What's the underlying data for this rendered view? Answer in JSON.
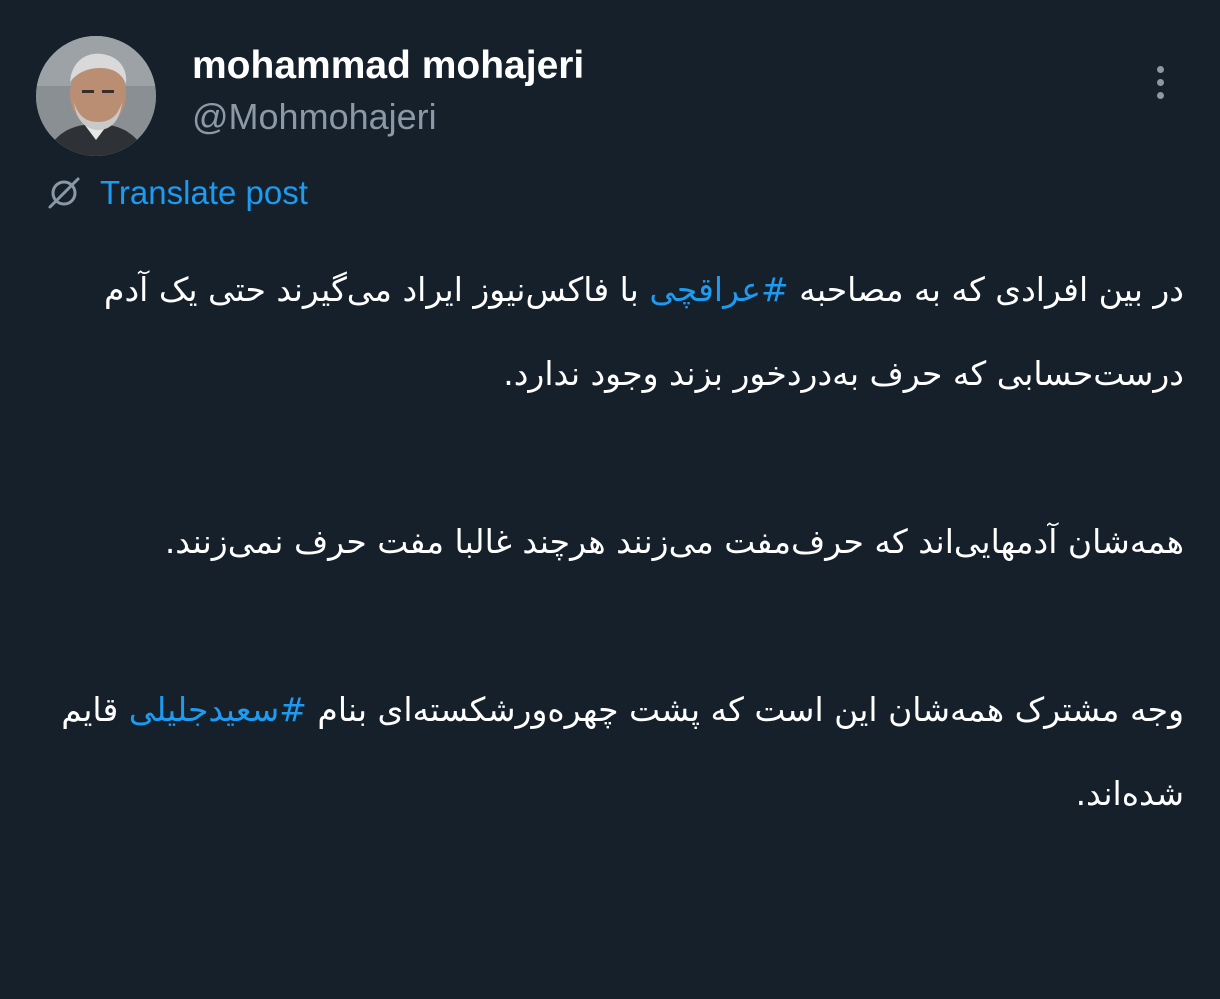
{
  "author": {
    "display_name": "mohammad mohajeri",
    "handle": "@Mohmohajeri",
    "avatar_icon": "profile-photo"
  },
  "menu": {
    "more_icon": "more-vertical-icon"
  },
  "translate": {
    "label": "Translate post",
    "icon": "translate-icon"
  },
  "post": {
    "p1": {
      "before": "در بین افرادی که به مصاحبه ",
      "hashtag": "#عراقچی",
      "after": " با فاکس‌نیوز ایراد می‌گیرند حتی یک آدم درست‌حسابی که حرف به‌دردخور بزند وجود ندارد."
    },
    "p2": "همه‌شان آدمهایی‌اند که حرف‌مفت می‌زنند هرچند غالبا مفت حرف نمی‌زنند.",
    "p3": {
      "before": "وجه مشترک همه‌شان این است که پشت چهره‌ورشکسته‌ای بنام ",
      "hashtag": "#سعیدجلیلی",
      "after": " قایم شده‌اند."
    }
  },
  "colors": {
    "background": "#15202b",
    "link": "#1d9bf0",
    "secondary_text": "#8b98a5"
  }
}
